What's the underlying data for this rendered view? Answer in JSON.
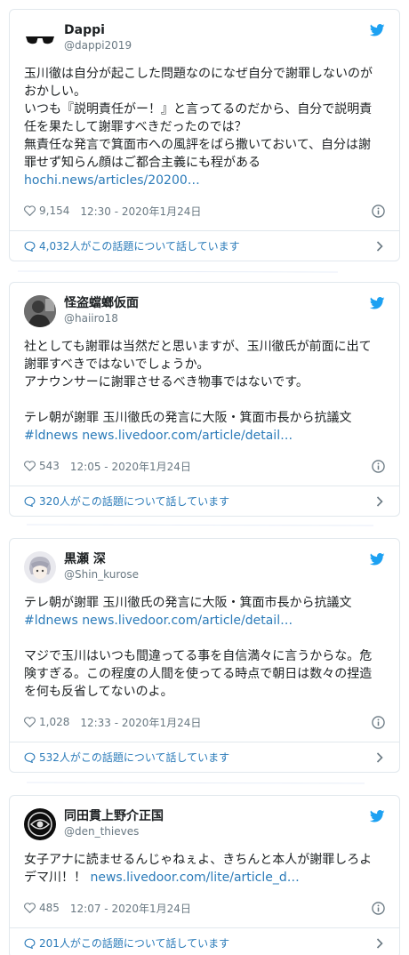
{
  "tweets": [
    {
      "name": "Dappi",
      "handle": "@dappi2019",
      "avatar": "sunglasses-avatar",
      "lines": [
        "玉川徹は自分が起こした問題なのになぜ自分で謝罪しないのが",
        "おかしい。",
        "いつも『説明責任がー！』と言ってるのだから、自分で説明責",
        "任を果たして謝罪すべきだったのでは？",
        "無責任な発言で箕面市への風評をばら撒いておいて、自分は謝",
        "罪せず知らん顔はご都合主義にも程がある"
      ],
      "link_line": "hochi.news/articles/20200…",
      "likes": "9,154",
      "timestamp": "12:30 - 2020年1月24日",
      "conversation": "4,032人がこの話題について話しています"
    },
    {
      "name": "怪盗蟷螂仮面",
      "handle": "@haiiro18",
      "avatar": "person-avatar",
      "lines": [
        "社としても謝罪は当然だと思いますが、玉川徹氏が前面に出て",
        "謝罪すべきではないでしょうか。",
        "アナウンサーに謝罪させるべき物事ではないです。",
        "",
        "テレ朝が謝罪 玉川徹氏の発言に大阪・箕面市長から抗議文"
      ],
      "link_line": "#ldnews news.livedoor.com/article/detail…",
      "likes": "543",
      "timestamp": "12:05 - 2020年1月24日",
      "conversation": "320人がこの話題について話しています"
    },
    {
      "name": "黒瀬 深",
      "handle": "@Shin_kurose",
      "avatar": "anime-avatar",
      "lines": [
        "テレ朝が謝罪 玉川徹氏の発言に大阪・箕面市長から抗議文"
      ],
      "link_line": "#ldnews news.livedoor.com/article/detail…",
      "lines_after": [
        "",
        "マジで玉川はいつも間違ってる事を自信満々に言うからな。危",
        "険すぎる。この程度の人間を使ってる時点で朝日は数々の捏造",
        "を何も反省してないのよ。"
      ],
      "likes": "1,028",
      "timestamp": "12:33 - 2020年1月24日",
      "conversation": "532人がこの話題について話しています"
    },
    {
      "name": "同田貫上野介正国",
      "handle": "@den_thieves",
      "avatar": "emblem-avatar",
      "lines": [
        "女子アナに読ませるんじゃねぇよ、きちんと本人が謝罪しろよ"
      ],
      "mixed_prefix": "デマ川！！ ",
      "mixed_link": "news.livedoor.com/lite/article_d…",
      "likes": "485",
      "timestamp": "12:07 - 2020年1月24日",
      "conversation": "201人がこの話題について話しています"
    }
  ],
  "colors": {
    "link": "#2b7bb9",
    "twitter_blue": "#1da1f2",
    "meta_gray": "#697882",
    "border": "#e1e8ed"
  },
  "icons": [
    "twitter-bird-icon",
    "heart-icon",
    "info-icon",
    "speech-bubble-icon",
    "chevron-right-icon"
  ]
}
